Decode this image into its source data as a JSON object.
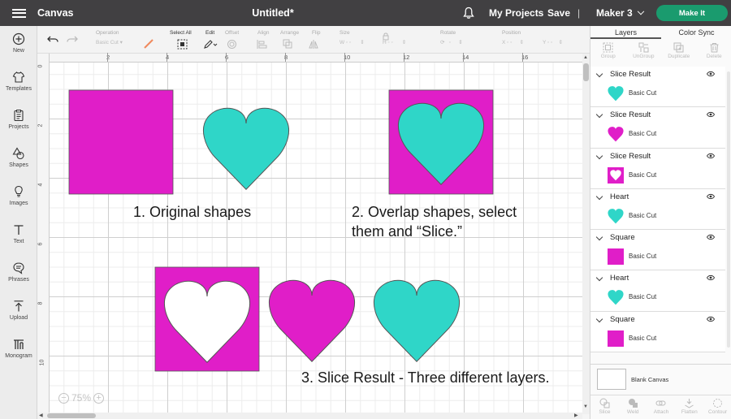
{
  "topbar": {
    "app_title": "Canvas",
    "doc_title": "Untitled*",
    "my_projects": "My Projects",
    "save": "Save",
    "separator": "|",
    "machine": "Maker 3",
    "make_it": "Make It",
    "make_it_color": "#1a9b6e"
  },
  "leftbar": {
    "items": [
      {
        "label": "New",
        "icon": "plus-circle-icon"
      },
      {
        "label": "Templates",
        "icon": "shirt-icon"
      },
      {
        "label": "Projects",
        "icon": "clipboard-icon"
      },
      {
        "label": "Shapes",
        "icon": "shapes-icon"
      },
      {
        "label": "Images",
        "icon": "lightbulb-icon"
      },
      {
        "label": "Text",
        "icon": "text-icon"
      },
      {
        "label": "Phrases",
        "icon": "speech-bubble-icon"
      },
      {
        "label": "Upload",
        "icon": "upload-icon"
      },
      {
        "label": "Monogram",
        "icon": "monogram-icon"
      }
    ]
  },
  "toolbar": {
    "operation_label": "Operation",
    "operation_value": "Basic Cut",
    "select_all_label": "Select All",
    "edit_label": "Edit",
    "offset_label": "Offset",
    "align_label": "Align",
    "arrange_label": "Arrange",
    "flip_label": "Flip",
    "size_label": "Size",
    "size_w": "W",
    "size_h": "H",
    "rotate_label": "Rotate",
    "position_label": "Position",
    "position_x": "X",
    "position_y": "Y"
  },
  "ruler": {
    "top_ticks": [
      "2",
      "4",
      "6",
      "8",
      "10",
      "12",
      "14",
      "16"
    ],
    "left_ticks": [
      "0",
      "2",
      "4",
      "6",
      "8",
      "10"
    ]
  },
  "canvas": {
    "zoom": "75%",
    "annotations": {
      "step1": "1. Original shapes",
      "step2_line1": "2. Overlap shapes, select",
      "step2_line2": "them and “Slice.”",
      "step3": "3. Slice Result - Three different layers."
    },
    "colors": {
      "magenta": "#e01ec8",
      "teal": "#2fd6c8",
      "shape_stroke": "#555555"
    }
  },
  "right_panel": {
    "tabs": [
      "Layers",
      "Color Sync"
    ],
    "actions": [
      "Group",
      "UnGroup",
      "Duplicate",
      "Delete"
    ],
    "layers": [
      {
        "name": "Slice Result",
        "operation": "Basic Cut",
        "thumb": "heart",
        "color": "#2fd6c8"
      },
      {
        "name": "Slice Result",
        "operation": "Basic Cut",
        "thumb": "heart",
        "color": "#e01ec8"
      },
      {
        "name": "Slice Result",
        "operation": "Basic Cut",
        "thumb": "square-heart",
        "color": "#e01ec8"
      },
      {
        "name": "Heart",
        "operation": "Basic Cut",
        "thumb": "heart",
        "color": "#2fd6c8"
      },
      {
        "name": "Square",
        "operation": "Basic Cut",
        "thumb": "square",
        "color": "#e01ec8"
      },
      {
        "name": "Heart",
        "operation": "Basic Cut",
        "thumb": "heart",
        "color": "#2fd6c8"
      },
      {
        "name": "Square",
        "operation": "Basic Cut",
        "thumb": "square",
        "color": "#e01ec8"
      }
    ],
    "blank_canvas": "Blank Canvas",
    "bottom_actions": [
      "Slice",
      "Weld",
      "Attach",
      "Flatten",
      "Contour"
    ]
  }
}
